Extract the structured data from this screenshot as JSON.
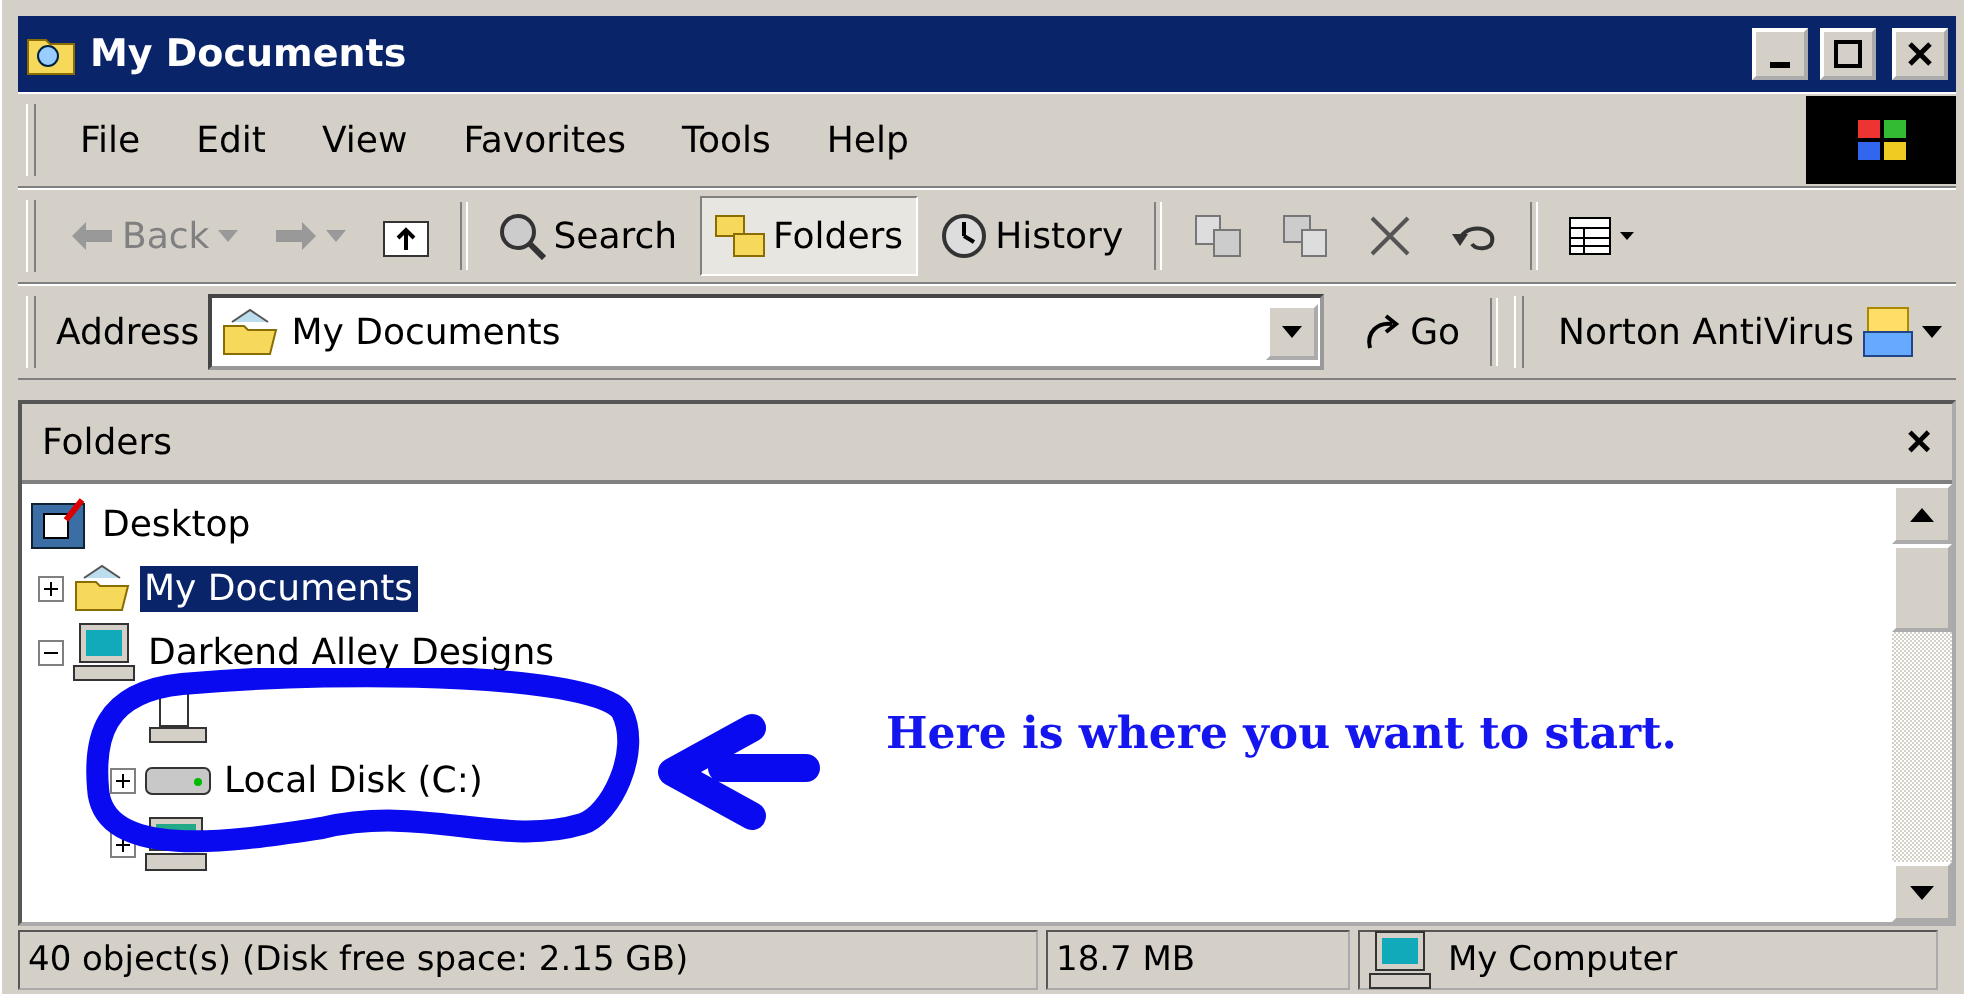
{
  "window": {
    "title": "My Documents"
  },
  "menu": [
    {
      "label": "File",
      "selected": false
    },
    {
      "label": "Edit",
      "selected": false
    },
    {
      "label": "View",
      "selected": false
    },
    {
      "label": "Favorites",
      "selected": false
    },
    {
      "label": "Tools",
      "selected": false
    },
    {
      "label": "Help",
      "selected": false
    }
  ],
  "toolbar": [
    {
      "kind": "back",
      "label": "Back",
      "disabled": true
    },
    {
      "kind": "forward",
      "disabled": true
    },
    {
      "kind": "up"
    },
    {
      "kind": "separator"
    },
    {
      "kind": "search",
      "label": "Search",
      "selected": false
    },
    {
      "kind": "folders",
      "label": "Folders",
      "selected": true
    },
    {
      "kind": "history",
      "label": "History",
      "selected": false
    },
    {
      "kind": "separator"
    },
    {
      "kind": "move"
    },
    {
      "kind": "copy"
    },
    {
      "kind": "delete"
    },
    {
      "kind": "undo"
    },
    {
      "kind": "separator"
    },
    {
      "kind": "views"
    }
  ],
  "address": {
    "label": "Address",
    "value": "My Documents",
    "go": "Go"
  },
  "links": {
    "label": "Norton AntiVirus"
  },
  "folders_pane": {
    "title": "Folders",
    "close": "×"
  },
  "tree": [
    {
      "kind": "desktop",
      "label": "Desktop",
      "selected": false,
      "children": [
        {
          "kind": "documents",
          "label": "My Documents",
          "selected": true,
          "expanded": false
        },
        {
          "kind": "computer",
          "label": "Darkend Alley Designs",
          "selected": false,
          "expanded": true,
          "children": [
            {
              "kind": "floppy"
            },
            {
              "kind": "disk",
              "label": "Local Disk (C:)",
              "selected": false,
              "expanded": false
            },
            {
              "kind": "cd",
              "expanded": false
            }
          ]
        }
      ]
    }
  ],
  "annotation": {
    "text": "Here is where you want to start."
  },
  "status_bar": [
    "40 object(s) (Disk free space: 2.15 GB)",
    "18.7 MB",
    "My Computer"
  ]
}
